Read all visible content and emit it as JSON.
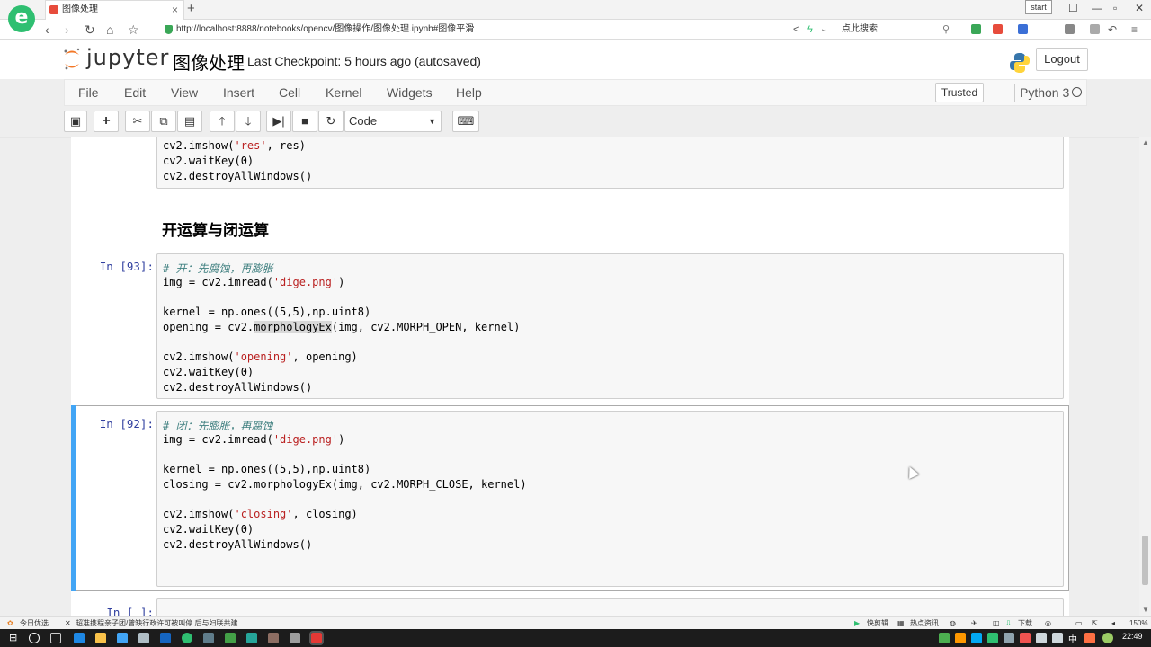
{
  "browser": {
    "logo": "e",
    "tab_title": "图像处理",
    "tab_close": "×",
    "new_tab": "+",
    "url": "http://localhost:8888/notebooks/opencv/图像操作/图像处理.ipynb#图像平滑",
    "search_placeholder": "点此搜索",
    "overlay_text": "start",
    "brand_color": "#2fbf71"
  },
  "jupyter": {
    "logo_text": "jupyter",
    "notebook_name": "图像处理",
    "checkpoint": "Last Checkpoint: 5 hours ago (autosaved)",
    "logout_label": "Logout",
    "menus": [
      "File",
      "Edit",
      "View",
      "Insert",
      "Cell",
      "Kernel",
      "Widgets",
      "Help"
    ],
    "trusted_label": "Trusted",
    "kernel_name": "Python 3",
    "cell_type": "Code",
    "accent_color": "#42a5f5",
    "logo_color": "#f37726"
  },
  "cells": {
    "prev": {
      "lines": [
        "cv2.imshow('res', res)",
        "cv2.waitKey(0)",
        "cv2.destroyAllWindows()"
      ]
    },
    "heading": "开运算与闭运算",
    "open": {
      "prompt": "In [93]:",
      "comment": "# 开：先腐蚀，再膨胀",
      "line1_a": "img = cv2.imread(",
      "line1_s": "'dige.png'",
      "line1_b": ")",
      "line2": "kernel = np.ones((5,5),np.uint8)",
      "line3_a": "opening = cv2.",
      "line3_h": "morphologyEx",
      "line3_b": "(img, cv2.MORPH_OPEN, kernel)",
      "line4_a": "cv2.imshow(",
      "line4_s": "'opening'",
      "line4_b": ", opening)",
      "line5": "cv2.waitKey(0)",
      "line6": "cv2.destroyAllWindows()"
    },
    "close": {
      "prompt": "In [92]:",
      "comment": "# 闭：先膨胀，再腐蚀",
      "line1_a": "img = cv2.imread(",
      "line1_s": "'dige.png'",
      "line1_b": ")",
      "line2": "kernel = np.ones((5,5),np.uint8)",
      "line3": "closing = cv2.morphologyEx(img, cv2.MORPH_CLOSE, kernel)",
      "line4_a": "cv2.imshow(",
      "line4_s": "'closing'",
      "line4_b": ", closing)",
      "line5": "cv2.waitKey(0)",
      "line6": "cv2.destroyAllWindows()"
    },
    "next_prompt": "In [ ]:"
  },
  "statusbar": {
    "left1": "今日优选",
    "left2": "超准携程亲子团/曾缺行政许可被叫停 后与妇联共建",
    "quick_cut": "快剪辑",
    "hot_news": "热点资讯",
    "download": "下载",
    "zoom": "150%"
  },
  "taskbar": {
    "clock": "22:49",
    "ime": "中"
  }
}
